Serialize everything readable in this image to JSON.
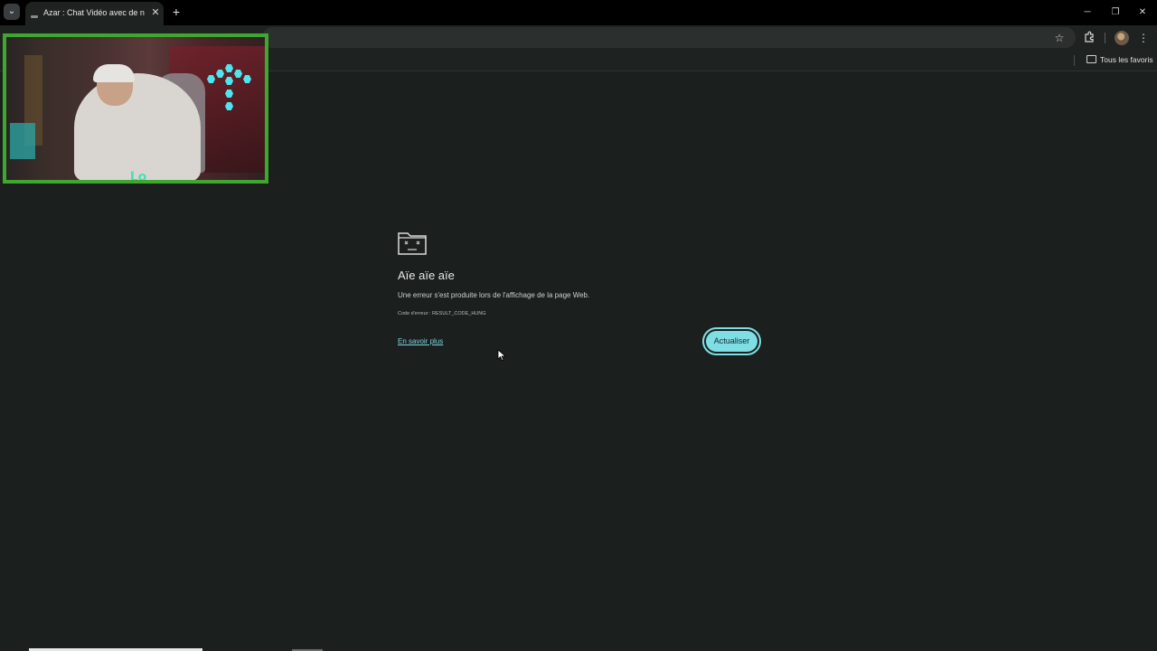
{
  "browser": {
    "tab": {
      "title": "Azar : Chat Vidéo avec de nouv"
    },
    "new_tab_symbol": "+",
    "tab_close_symbol": "✕",
    "window_controls": {
      "minimize": "─",
      "restore": "❐",
      "close": "✕"
    },
    "bookmarks_bar": {
      "all_bookmarks_label": "Tous les favoris"
    }
  },
  "error_page": {
    "title": "Aïe aïe aïe",
    "description": "Une erreur s'est produite lors de l'affichage de la page Web.",
    "error_code": "Code d'erreur : RESULT_CODE_HUNG",
    "learn_more_label": "En savoir plus",
    "reload_label": "Actualiser"
  },
  "colors": {
    "page_background": "#1b1f1e",
    "accent": "#7fdde4",
    "webcam_border": "#3ea82e"
  },
  "icons": {
    "tab_search": "chevron-down-icon",
    "bookmark_star": "star-icon",
    "extensions": "puzzle-icon",
    "menu": "kebab-menu-icon",
    "error": "sad-folder-icon"
  }
}
